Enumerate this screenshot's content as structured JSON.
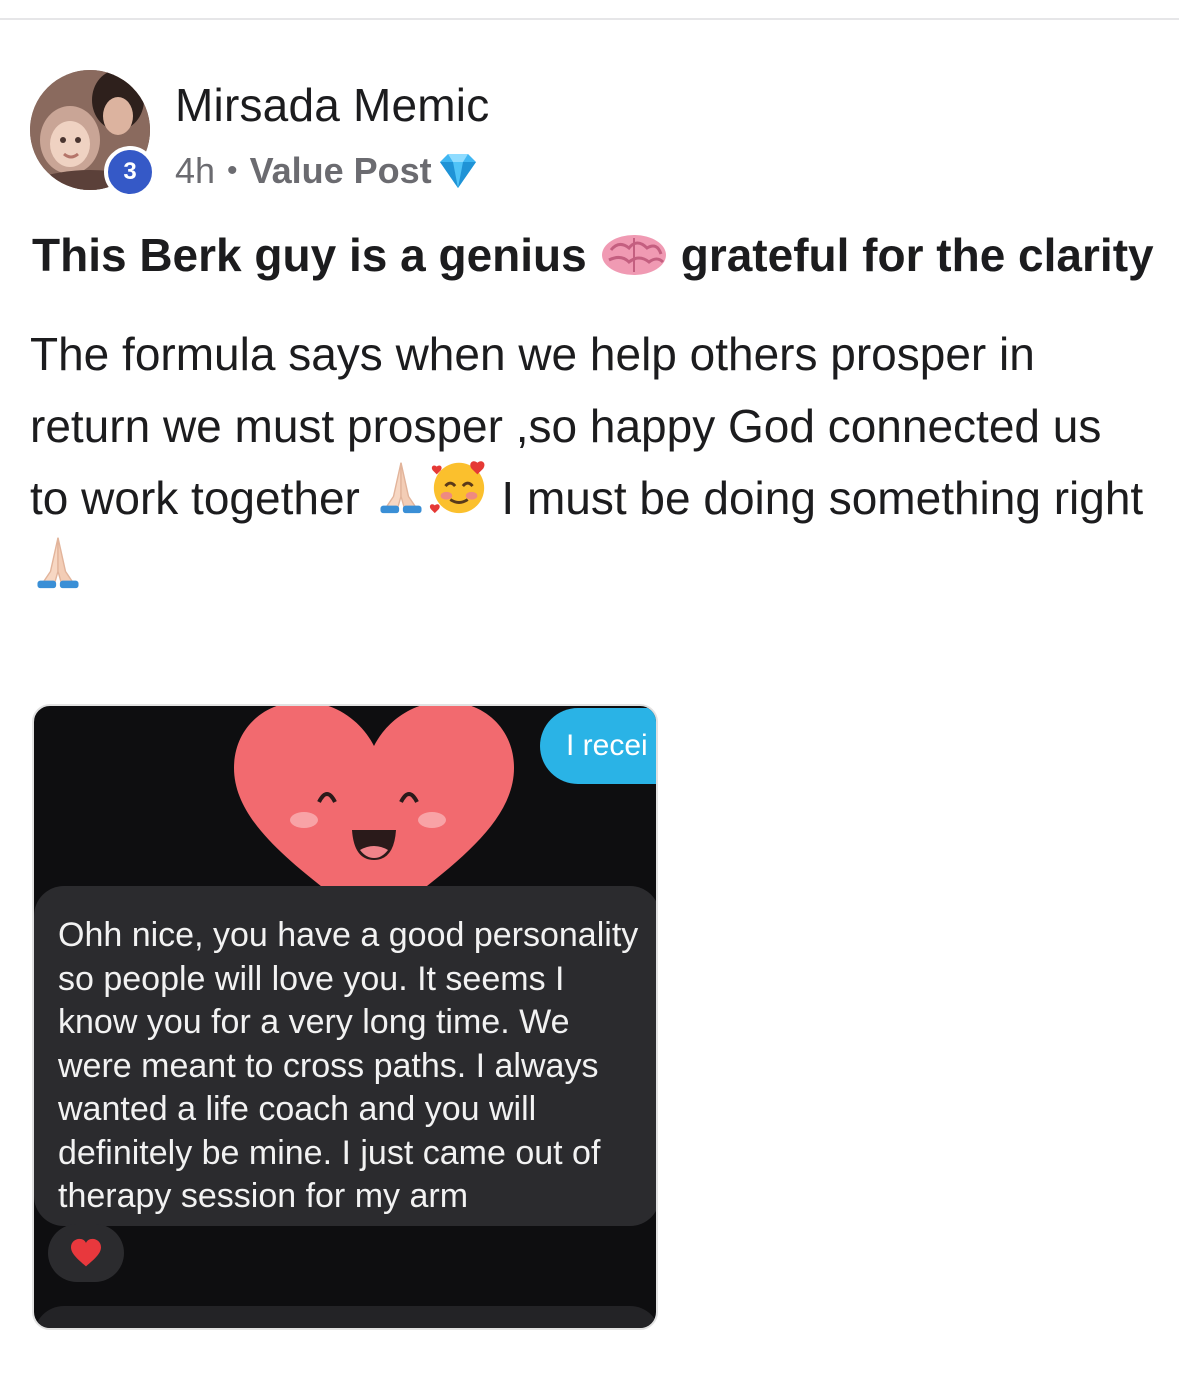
{
  "post": {
    "author": "Mirsada Memic",
    "level": "3",
    "time": "4h",
    "separator": "•",
    "category": "Value Post",
    "title_before": "This Berk guy is a genius",
    "title_after": "grateful for the clarity",
    "body": {
      "part1": "The formula says when we help others prosper in return we must prosper ,so happy God connected us to work together ",
      "part2": " I must be doing something right "
    }
  },
  "icons": {
    "category_icon": "gem-icon",
    "title_icon": "brain-icon",
    "emoji_1": "pray-icon",
    "emoji_2": "smiling-face-with-hearts-icon",
    "emoji_3": "pray-icon",
    "reaction": "heart-icon"
  },
  "attachment": {
    "sent_message": "I recei",
    "received_message": "Ohh nice, you have a good personality so people will love you. It seems I know you for a very long time. We were meant to cross paths. I always wanted a life coach and you will definitely be mine. I just came out of therapy session for my arm"
  },
  "colors": {
    "level_badge": "#3559c7",
    "gem": "#3fb6f2",
    "sent_bubble": "#2ab3e6",
    "heart_sticker": "#f26a6f",
    "dark_background": "#0e0e10",
    "received_bubble": "#2b2b2e"
  }
}
